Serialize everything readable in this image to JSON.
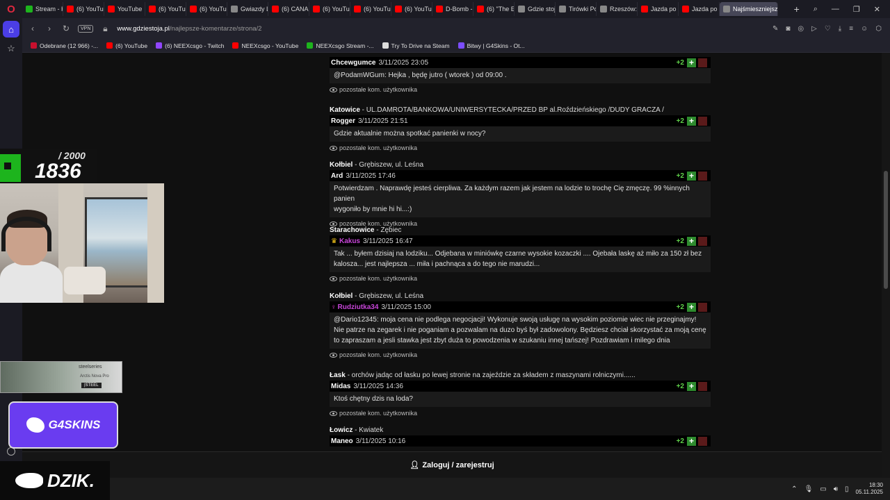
{
  "tabs": [
    {
      "label": "Stream - K",
      "color": "#1db41d"
    },
    {
      "label": "(6) YouTub",
      "color": "#ff0000"
    },
    {
      "label": "YouTube",
      "color": "#ff0000"
    },
    {
      "label": "(6) YouTub",
      "color": "#ff0000"
    },
    {
      "label": "(6) YouTub",
      "color": "#ff0000"
    },
    {
      "label": "Gwiazdy L",
      "color": "#888888"
    },
    {
      "label": "(6) CANAL",
      "color": "#ff0000"
    },
    {
      "label": "(6) YouTub",
      "color": "#ff0000"
    },
    {
      "label": "(6) YouTub",
      "color": "#ff0000"
    },
    {
      "label": "(6) YouTub",
      "color": "#ff0000"
    },
    {
      "label": "D-Bomb -",
      "color": "#ff0000"
    },
    {
      "label": "(6) \"The E",
      "color": "#ff0000"
    },
    {
      "label": "Gdzie stoj",
      "color": "#888888"
    },
    {
      "label": "Tirówki Po",
      "color": "#888888"
    },
    {
      "label": "Rzeszów:",
      "color": "#888888"
    },
    {
      "label": "Jazda po",
      "color": "#ff0000"
    },
    {
      "label": "Jazda po",
      "color": "#ff0000"
    },
    {
      "label": "Najśmieszniejsze",
      "color": "#888888",
      "active": true
    }
  ],
  "address": {
    "vpn": "VPN",
    "host": "www.gdziestoja.pl",
    "path": "/najlepsze-komentarze/strona/2"
  },
  "bookmarks": [
    {
      "label": "Odebrane (12 966) -...",
      "color": "#c8102e"
    },
    {
      "label": "(6) YouTube",
      "color": "#ff0000"
    },
    {
      "label": "(6) NEEXcsgo - Twitch",
      "color": "#9146ff"
    },
    {
      "label": "NEEXcsgo - YouTube",
      "color": "#ff0000"
    },
    {
      "label": "NEEXcsgo Stream -...",
      "color": "#1db41d"
    },
    {
      "label": "Try To Drive na Steam",
      "color": "#dddddd"
    },
    {
      "label": "Bitwy | G4Skins - Ot...",
      "color": "#7c4dff"
    }
  ],
  "entries": [
    {
      "city": "",
      "street": "",
      "user": "Chcewgumce",
      "date": "3/11/2025 23:05",
      "score": "+2",
      "lines": [
        "@PodamWGum: Hejka , będę jutro ( wtorek ) od 09:00 ."
      ],
      "more": "pozostałe kom. użytkownika"
    },
    {
      "city": "Katowice",
      "street": " - UL.DAMROTA/BANKOWA/UNIWERSYTECKA/PRZED BP al.Roździeńskiego /DUDY GRACZA /",
      "user": "Rogger",
      "date": "3/11/2025 21:51",
      "score": "+2",
      "lines": [
        "Gdzie aktualnie można spotkać panienki w nocy?"
      ],
      "more": "pozostałe kom. użytkownika"
    },
    {
      "city": "Kołbiel",
      "street": " - Grębiszew, ul. Leśna",
      "user": "Ard",
      "date": "3/11/2025 17:46",
      "score": "+2",
      "lines": [
        "Potwierdzam . Naprawdę jesteś cierpliwa. Za każdym razem jak jestem na lodzie to trochę Cię zmęczę. 99 %innych panien",
        "wygoniło by mnie hi hi...:)"
      ],
      "more": "pozostałe kom. użytkownika"
    },
    {
      "city": "Starachowice",
      "street": " - Zębiec",
      "user": "Kakus",
      "date": "3/11/2025 16:47",
      "score": "+2",
      "badge": "crown",
      "lines": [
        "Tak ... byłem dzisiaj na lodziku... Odjebana w miniówkę czarne wysokie kozaczki .... Ojebała laskę aż miło za 150 zł bez",
        "kalosza... jest najlepsza ... miła i pachnąca a do tego nie marudzi..."
      ],
      "more": "pozostałe kom. użytkownika"
    },
    {
      "city": "Kołbiel",
      "street": " - Grębiszew, ul. Leśna",
      "user": "Rudziutka34",
      "date": "3/11/2025 15:00",
      "score": "+2",
      "badge": "female",
      "lines": [
        "@Dario12345: moja cena nie podlega negocjacji! Wykonuje swoją usługę na wysokim poziomie wiec nie przeginajmy!",
        "Nie patrze na zegarek i nie poganiam a pozwalam na duzo byś był zadowolony. Będziesz chciał skorzystać za moją cenę",
        "to zapraszam a jesli stawka jest zbyt duża to powodzenia w szukaniu innej tańszej! Pozdrawiam i milego dnia"
      ],
      "more": "pozostałe kom. użytkownika"
    },
    {
      "city": "Łask",
      "street": " - orchów jadąc od łasku po lewej stronie na zajeździe za składem z maszynami rolniczymi......",
      "user": "Midas",
      "date": "3/11/2025 14:36",
      "score": "+2",
      "lines": [
        "Ktoś chętny dzis na loda?"
      ],
      "more": "pozostałe kom. użytkownika"
    },
    {
      "city": "Łowicz",
      "street": " - Kwiatek",
      "user": "Maneo",
      "date": "3/11/2025 10:16",
      "score": "+2",
      "lines": [],
      "more": ""
    }
  ],
  "login": "Zaloguj / zarejestruj",
  "overlay": {
    "total": "/ 2000",
    "current": "1836",
    "steel_brand": "steelseries",
    "steel_product": "Arctis Nova Pro",
    "steel_cta": "|STEEL",
    "g4": "G4SKINS",
    "dzik": "DZIK."
  },
  "clock": {
    "time": "18:30",
    "date": "05.11.2025"
  }
}
